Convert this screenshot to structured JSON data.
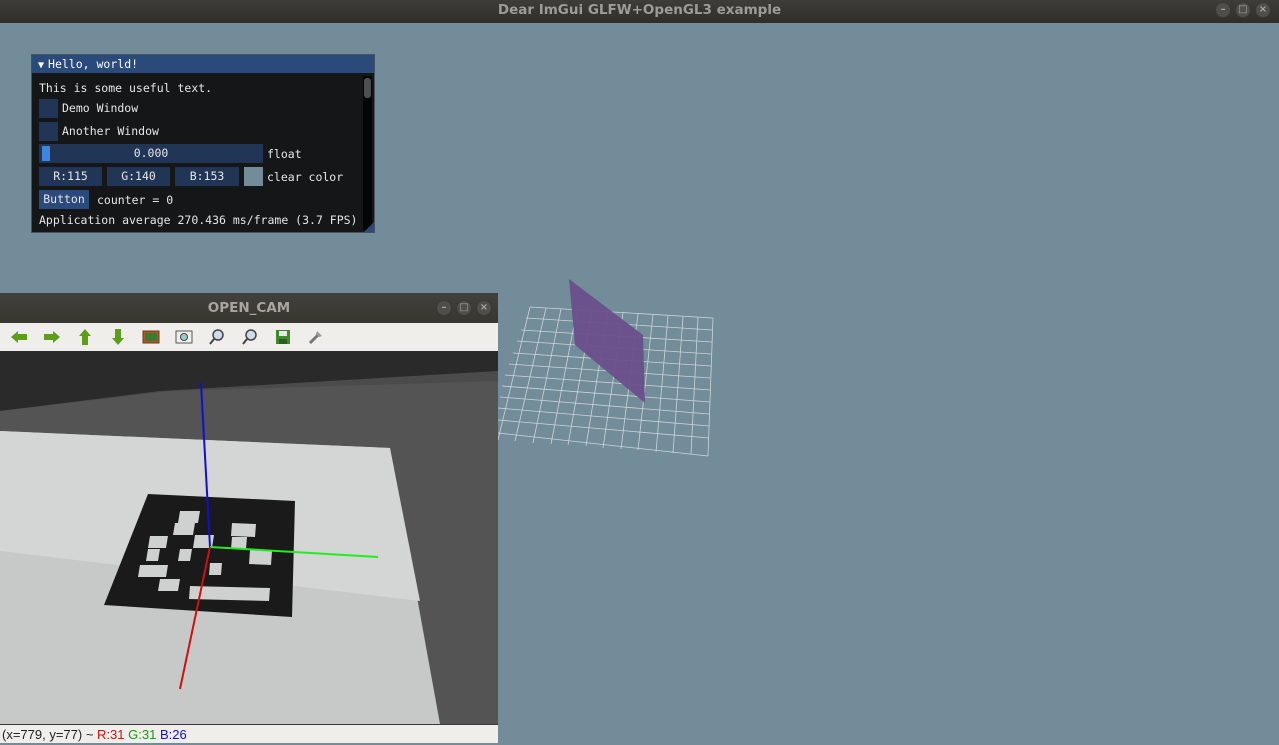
{
  "app": {
    "title": "Dear ImGui GLFW+OpenGL3 example",
    "window_buttons": [
      "–",
      "□",
      "×"
    ]
  },
  "imgui": {
    "title": "Hello, world!",
    "text": "This is some useful text.",
    "checkboxes": [
      {
        "label": "Demo Window",
        "checked": false
      },
      {
        "label": "Another Window",
        "checked": false
      }
    ],
    "slider": {
      "value": "0.000",
      "label": "float",
      "fraction": 0.0
    },
    "color": {
      "r": "R:115",
      "g": "G:140",
      "b": "B:153",
      "label": "clear color",
      "swatch": "#738c99"
    },
    "button": {
      "label": "Button"
    },
    "counter": "counter = 0",
    "perf": "Application average 270.436 ms/frame (3.7 FPS)"
  },
  "opencv": {
    "title": "OPEN_CAM",
    "window_buttons": [
      "–",
      "□",
      "×"
    ],
    "toolbar": [
      "arrow-left-icon",
      "arrow-right-icon",
      "arrow-up-icon",
      "arrow-down-icon",
      "image-icon",
      "zoom-fit-icon",
      "zoom-in-icon",
      "zoom-out-icon",
      "save-icon",
      "properties-icon"
    ],
    "status": {
      "coords": "(x=779, y=77) ~",
      "r": "R:31",
      "g": "G:31",
      "b": "B:26"
    }
  },
  "colors": {
    "background": "#738c99",
    "imgui_title": "#294a7a",
    "plane": "#6a4f8c"
  }
}
